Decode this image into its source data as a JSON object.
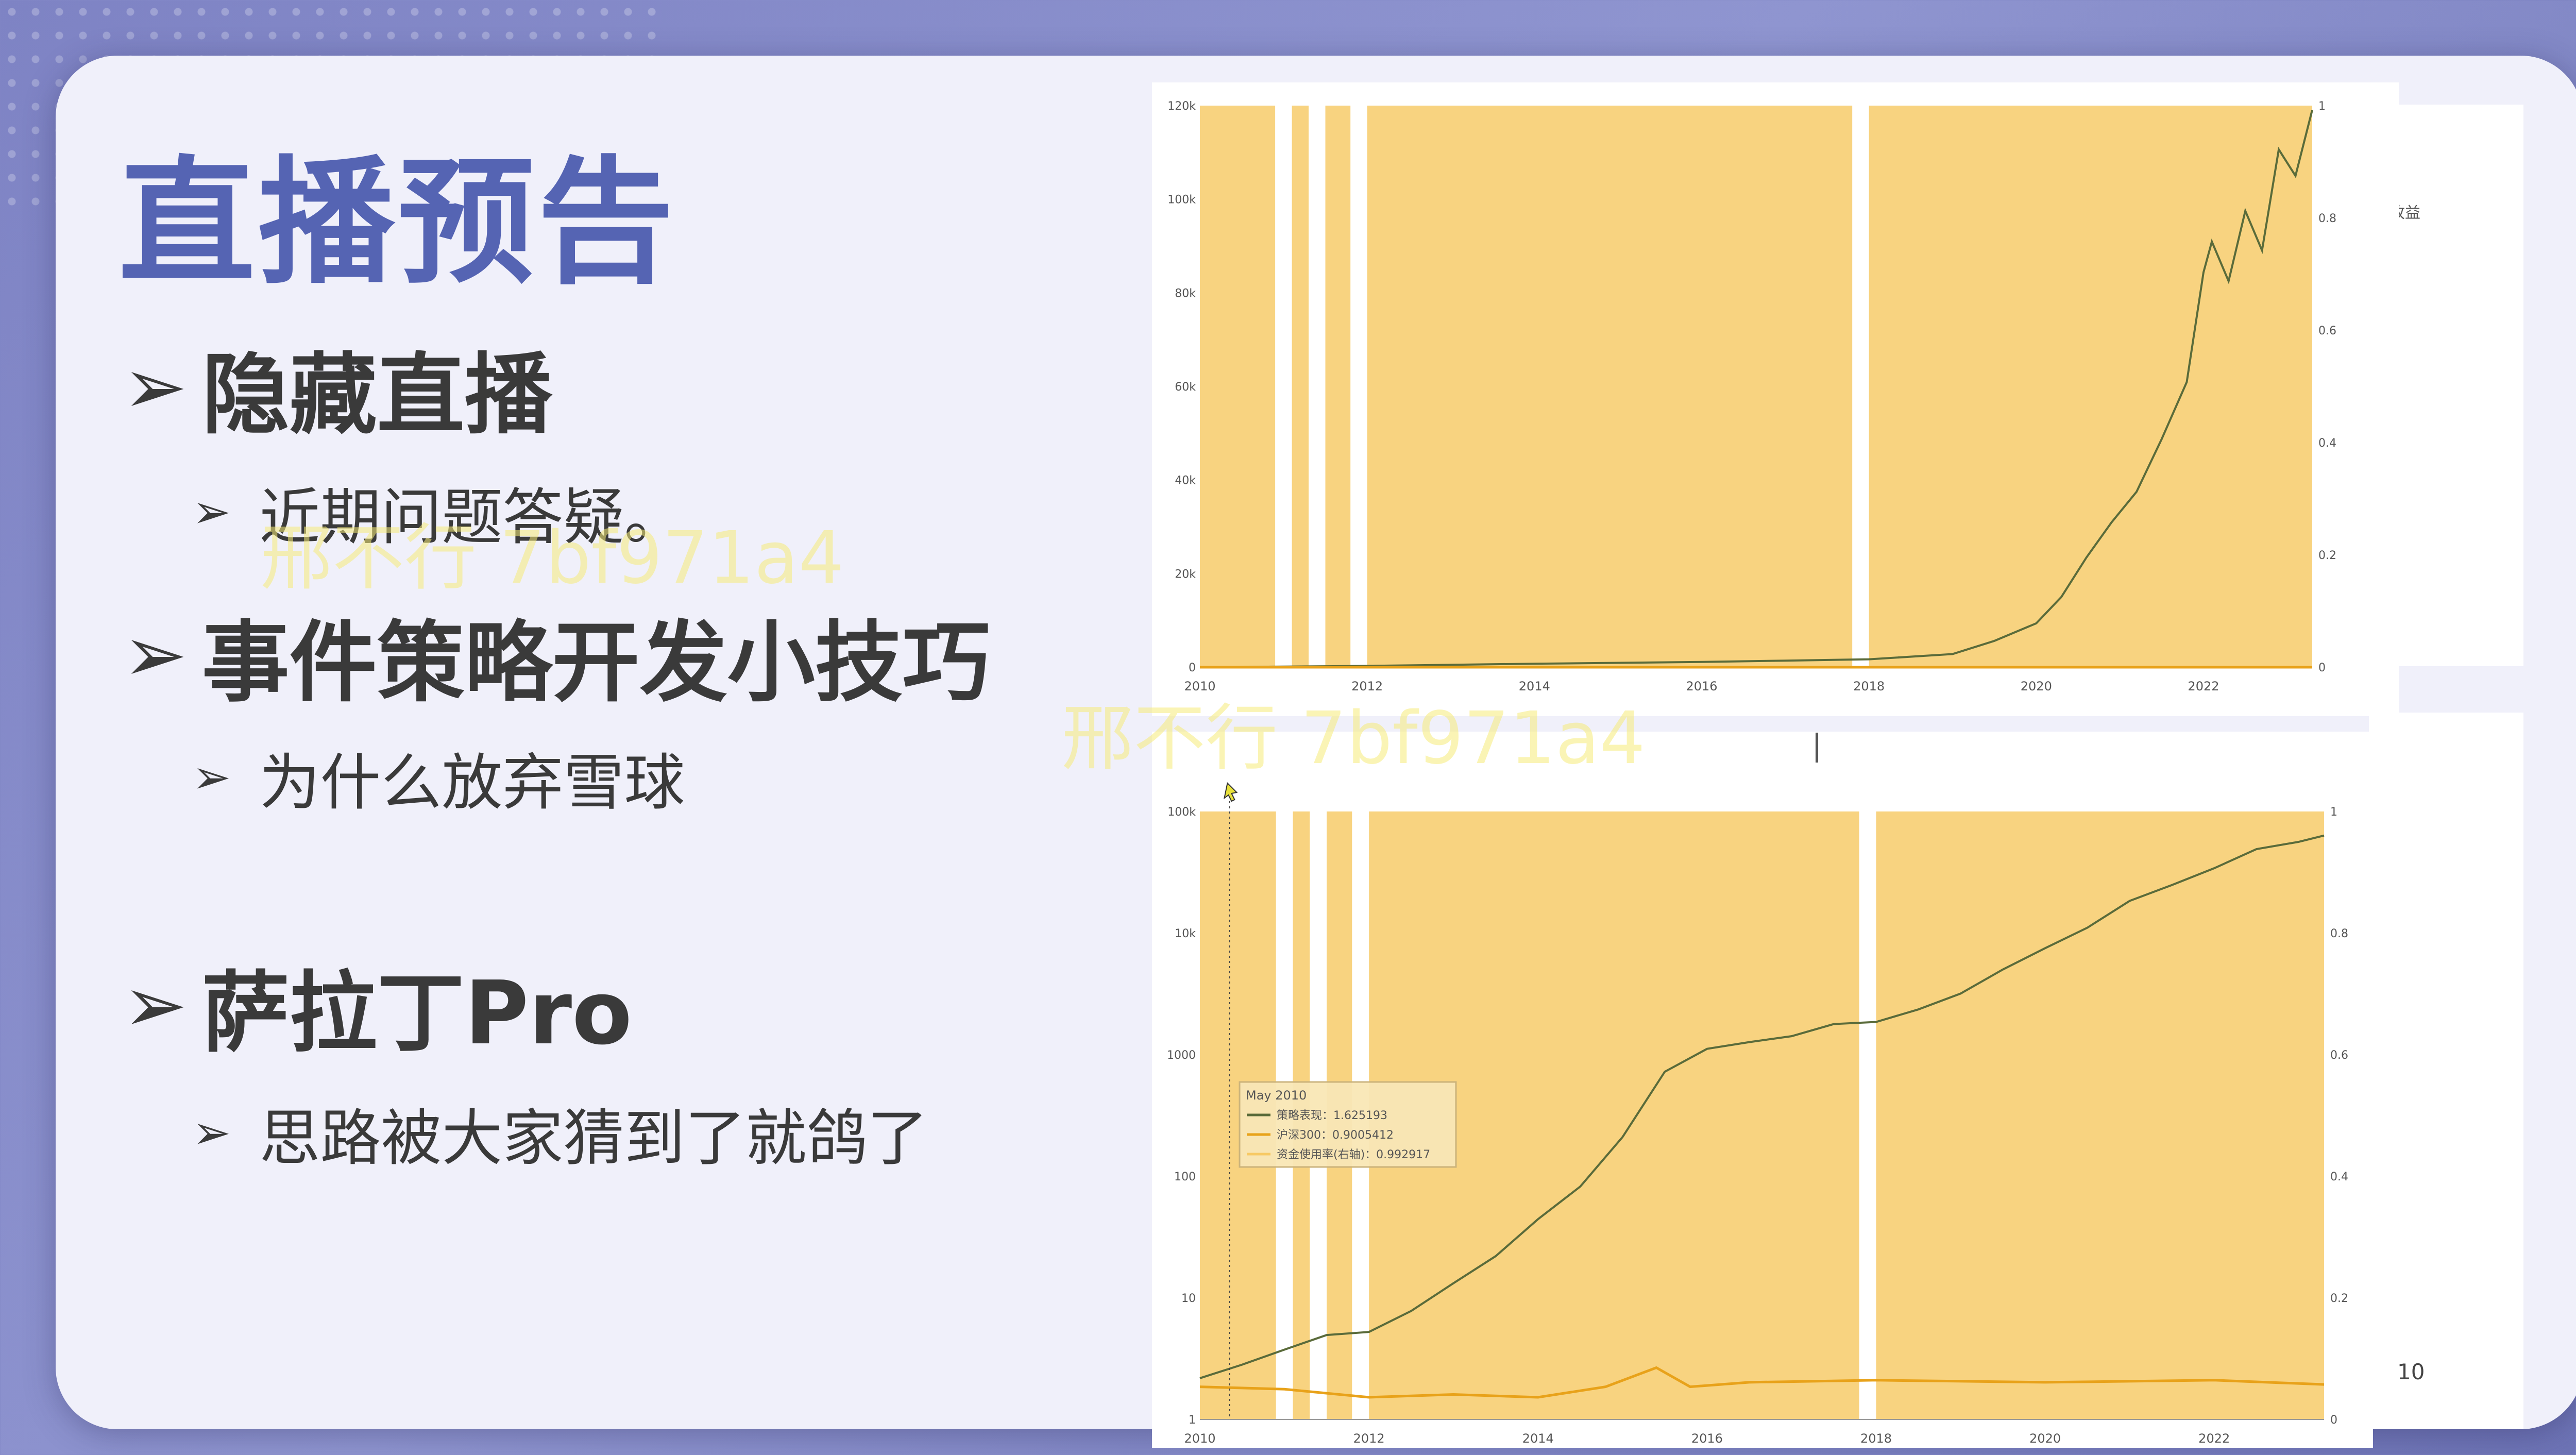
{
  "slide": {
    "title": "直播预告",
    "sections": [
      {
        "heading": "隐藏直播",
        "sub": "近期问题答疑。"
      },
      {
        "heading": "事件策略开发小技巧",
        "sub": "为什么放弃雪球"
      },
      {
        "heading": "萨拉丁Pro",
        "sub": "思路被大家猜到了就鸽了"
      }
    ],
    "arrow": "➢",
    "page_number": "10",
    "legend_fragment_1": "益",
    "legend_fragment_2": "得收益"
  },
  "watermarks": [
    "邢不行 7bf971a4",
    "邢不行 7bf971a4"
  ],
  "colors": {
    "bar": "#f7c964",
    "strategy": "#5a6b3a",
    "index": "#e8a21a"
  },
  "chart_data": [
    {
      "type": "line",
      "title": "",
      "xlabel": "",
      "ylabel": "",
      "y_tick_labels": [
        "0",
        "20k",
        "40k",
        "60k",
        "80k",
        "100k",
        "120k"
      ],
      "y2_tick_labels": [
        "0",
        "0.2",
        "0.4",
        "0.6",
        "0.8",
        "1"
      ],
      "x_tick_labels": [
        "2010",
        "2012",
        "2014",
        "2016",
        "2018",
        "2020",
        "2022"
      ],
      "ylim": [
        0,
        128000
      ],
      "y2lim": [
        0,
        1
      ],
      "xlim": [
        2010.0,
        2023.3
      ],
      "gaps": [
        [
          2010.9,
          2011.1
        ],
        [
          2011.3,
          2011.5
        ],
        [
          2011.8,
          2012.0
        ],
        [
          2017.8,
          2018.0
        ]
      ],
      "series": [
        {
          "key": "strategy",
          "x": [
            2010.0,
            2012.0,
            2014.0,
            2016.0,
            2017.0,
            2018.0,
            2019.0,
            2019.5,
            2020.0,
            2020.3,
            2020.6,
            2020.9,
            2021.2,
            2021.5,
            2021.8,
            2022.0,
            2022.1,
            2022.3,
            2022.5,
            2022.7,
            2022.9,
            2023.1,
            2023.3
          ],
          "y": [
            1,
            300,
            800,
            1200,
            1500,
            1800,
            3000,
            6000,
            10000,
            16000,
            25000,
            33000,
            40000,
            52000,
            65000,
            90000,
            97000,
            88000,
            104000,
            95000,
            118000,
            112000,
            127000
          ]
        },
        {
          "key": "index",
          "x": [
            2010.0,
            2023.3
          ],
          "y": [
            1,
            1
          ]
        }
      ]
    },
    {
      "type": "line",
      "title": "",
      "xlabel": "",
      "ylabel": "",
      "y_tick_labels": [
        "1",
        "10",
        "100",
        "1000",
        "10k",
        "100k"
      ],
      "y2_tick_labels": [
        "0",
        "0.2",
        "0.4",
        "0.6",
        "0.8",
        "1"
      ],
      "x_tick_labels": [
        "2010",
        "2012",
        "2014",
        "2016",
        "2018",
        "2020",
        "2022"
      ],
      "yscale": "log",
      "ylim": [
        0.5,
        200000
      ],
      "y2lim": [
        0,
        1
      ],
      "xlim": [
        2010.0,
        2023.3
      ],
      "gaps": [
        [
          2010.9,
          2011.1
        ],
        [
          2011.3,
          2011.5
        ],
        [
          2011.8,
          2012.0
        ],
        [
          2017.8,
          2018.0
        ]
      ],
      "series": [
        {
          "key": "strategy",
          "x": [
            2010.0,
            2010.5,
            2011.0,
            2011.5,
            2012.0,
            2012.5,
            2013.0,
            2013.5,
            2014.0,
            2014.5,
            2015.0,
            2015.5,
            2016.0,
            2016.5,
            2017.0,
            2017.5,
            2018.0,
            2018.5,
            2019.0,
            2019.5,
            2020.0,
            2020.5,
            2021.0,
            2021.5,
            2022.0,
            2022.5,
            2023.0,
            2023.3
          ],
          "y": [
            1.2,
            1.6,
            2.2,
            3,
            3.2,
            5,
            9,
            16,
            35,
            70,
            200,
            800,
            1300,
            1500,
            1700,
            2200,
            2300,
            3000,
            4200,
            7000,
            11000,
            17000,
            30000,
            42000,
            60000,
            90000,
            105000,
            120000
          ]
        },
        {
          "key": "index",
          "x": [
            2010.0,
            2011.0,
            2012.0,
            2013.0,
            2014.0,
            2014.8,
            2015.4,
            2015.8,
            2016.5,
            2018.0,
            2020.0,
            2022.0,
            2023.3
          ],
          "y": [
            1.0,
            0.95,
            0.8,
            0.85,
            0.8,
            1.0,
            1.5,
            1.0,
            1.1,
            1.15,
            1.1,
            1.15,
            1.05
          ]
        }
      ],
      "tooltip": {
        "title": "May 2010",
        "rows": [
          {
            "label": "策略表现：1.625193",
            "key": "strategy"
          },
          {
            "label": "沪深300：0.9005412",
            "key": "index"
          },
          {
            "label": "资金使用率(右轴)：0.992917",
            "key": "bar"
          }
        ]
      }
    }
  ]
}
